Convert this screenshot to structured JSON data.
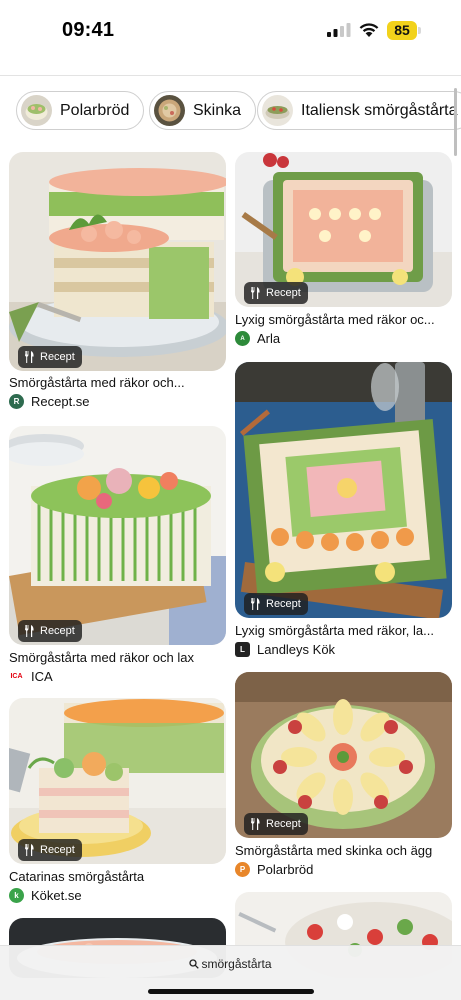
{
  "status_bar": {
    "time": "09:41",
    "battery": "85",
    "icons": [
      "signal-icon",
      "wifi-icon",
      "battery-icon"
    ]
  },
  "chips": [
    {
      "label": "Polarbröd"
    },
    {
      "label": "Skinka"
    },
    {
      "label": "Italiensk smörgåstårta"
    }
  ],
  "pins": [
    {
      "title": "Smörgåstårta med räkor och...",
      "source": "Recept.se",
      "badge": "Recept"
    },
    {
      "title": "Lyxig smörgåstårta med räkor oc...",
      "source": "Arla",
      "badge": "Recept"
    },
    {
      "title": "Smörgåstårta med räkor och lax",
      "source": "ICA",
      "badge": "Recept"
    },
    {
      "title": "Lyxig smörgåstårta med räkor, la...",
      "source": "Landleys Kök",
      "badge": "Recept"
    },
    {
      "title": "Catarinas smörgåstårta",
      "source": "Köket.se",
      "badge": "Recept"
    },
    {
      "title": "Smörgåstårta med skinka och ägg",
      "source": "Polarbröd",
      "badge": "Recept"
    }
  ],
  "bottom_bar": {
    "search_label": "smörgåstårta"
  },
  "colors": {
    "battery": "#f2d21b",
    "badge_bg": "#1e1e1e",
    "recept_logo": "#2e6b4f",
    "arla_logo": "#2d8a3a",
    "ica_logo": "#e3000f",
    "landleys_logo": "#222222",
    "koket_logo": "#3aa34a",
    "polarbrod_logo": "#e8862a"
  }
}
